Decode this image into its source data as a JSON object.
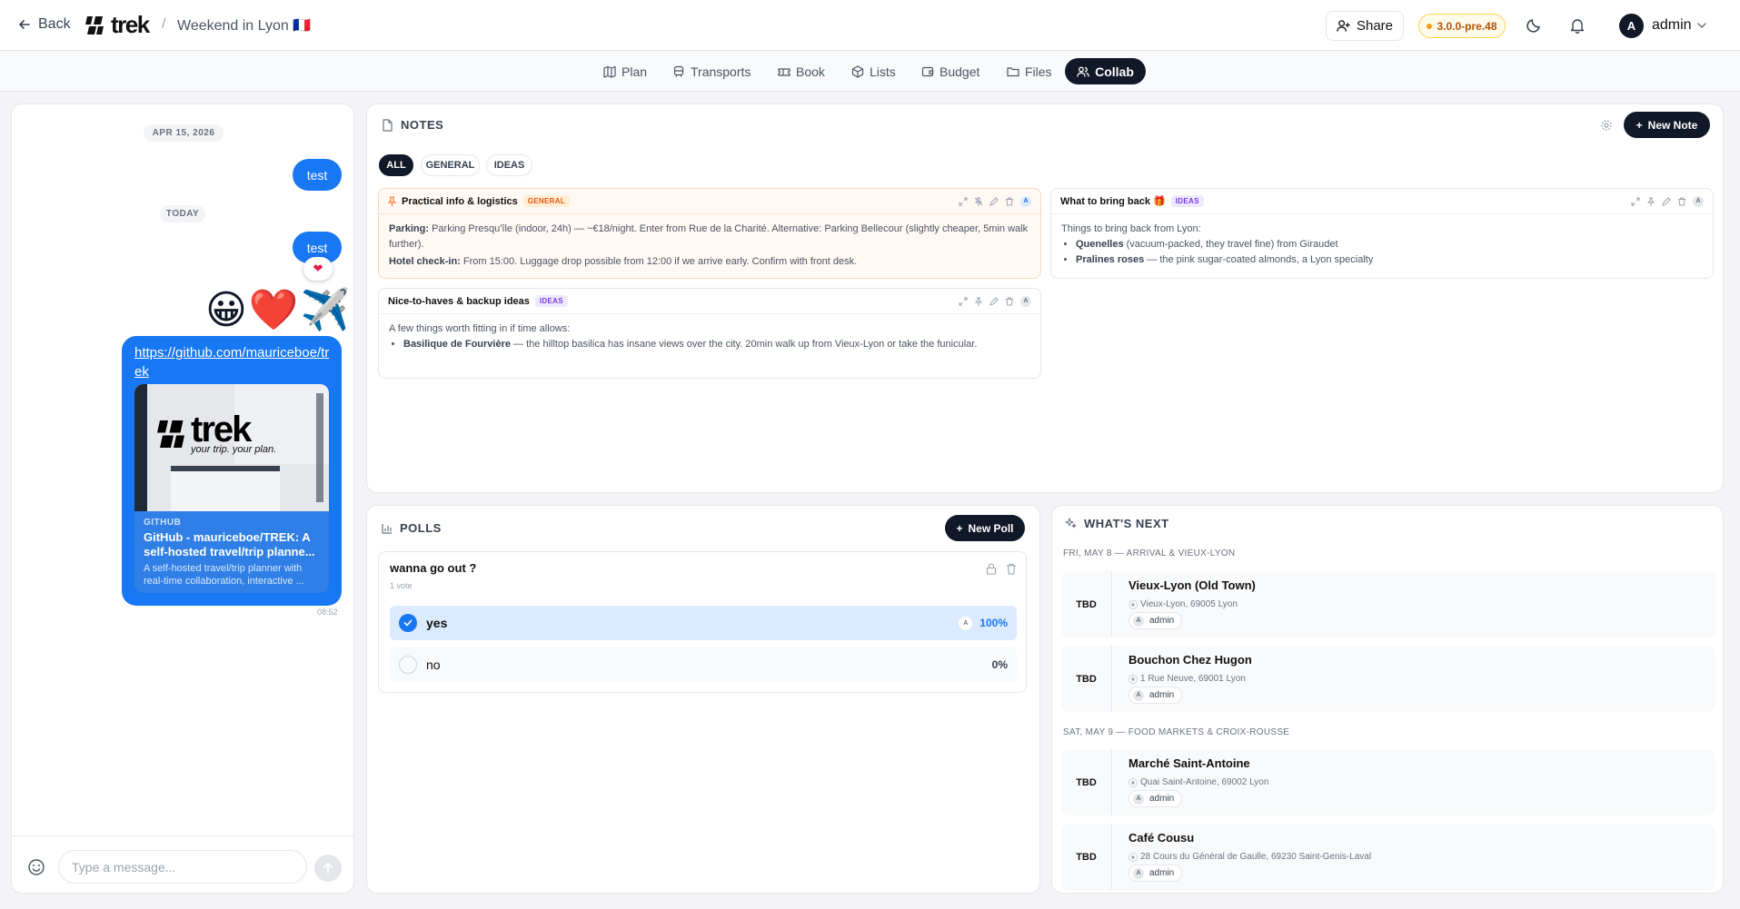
{
  "header": {
    "back_label": "Back",
    "logo_text": "trek",
    "separator": "/",
    "trip_title": "Weekend in Lyon 🇫🇷",
    "share_label": "Share",
    "version": "3.0.0-pre.48",
    "user_initial": "A",
    "user_name": "admin"
  },
  "tabs": [
    {
      "label": "Plan",
      "icon": "map-icon"
    },
    {
      "label": "Transports",
      "icon": "train-icon"
    },
    {
      "label": "Book",
      "icon": "ticket-icon"
    },
    {
      "label": "Lists",
      "icon": "package-icon"
    },
    {
      "label": "Budget",
      "icon": "wallet-icon"
    },
    {
      "label": "Files",
      "icon": "folder-icon"
    },
    {
      "label": "Collab",
      "icon": "users-icon",
      "active": true
    }
  ],
  "chat": {
    "date_old": "APR 15, 2026",
    "date_today": "TODAY",
    "msg1": "test",
    "msg2": "test",
    "reaction": "❤",
    "emoji_msg": "😀❤️✈️",
    "link_url": "https://github.com/mauriceboe/trek",
    "preview_logo": "trek",
    "preview_tagline": "your trip. your plan.",
    "preview_site": "GITHUB",
    "preview_title": "GitHub - mauriceboe/TREK: A self-hosted travel/trip planne...",
    "preview_desc": "A self-hosted travel/trip planner with real-time collaboration, interactive ...",
    "time": "08:52",
    "input_placeholder": "Type a message..."
  },
  "notes": {
    "title": "NOTES",
    "new_label": "New Note",
    "filters": [
      "ALL",
      "GENERAL",
      "IDEAS"
    ],
    "note1": {
      "title": "Practical info & logistics",
      "badge": "GENERAL",
      "line1_label": "Parking:",
      "line1_text": "Parking Presqu'île (indoor, 24h) — ~€18/night. Enter from Rue de la Charité. Alternative: Parking Bellecour (slightly cheaper, 5min walk further).",
      "line2_label": "Hotel check-in:",
      "line2_text": "From 15:00. Luggage drop possible from 12:00 if we arrive early. Confirm with front desk."
    },
    "note2": {
      "title": "What to bring back 🎁",
      "badge": "IDEAS",
      "intro": "Things to bring back from Lyon:",
      "item1_label": "Quenelles",
      "item1_text": "(vacuum-packed, they travel fine) from Giraudet",
      "item2_label": "Pralines roses",
      "item2_text": "— the pink sugar-coated almonds, a Lyon specialty"
    },
    "note3": {
      "title": "Nice-to-haves & backup ideas",
      "badge": "IDEAS",
      "intro": "A few things worth fitting in if time allows:",
      "item1_label": "Basilique de Fourvière",
      "item1_text": "— the hilltop basilica has insane views over the city. 20min walk up from Vieux-Lyon or take the funicular."
    },
    "author_initial": "A"
  },
  "polls": {
    "title": "POLLS",
    "new_label": "New Poll",
    "question": "wanna go out ?",
    "votes": "1 vote",
    "options": [
      {
        "label": "yes",
        "percent": "100%",
        "voter": "A",
        "selected": true
      },
      {
        "label": "no",
        "percent": "0%",
        "selected": false
      }
    ]
  },
  "whats_next": {
    "title": "WHAT'S NEXT",
    "days": [
      {
        "header": "FRI, MAY 8 — ARRIVAL & VIEUX-LYON",
        "items": [
          {
            "time": "TBD",
            "name": "Vieux-Lyon (Old Town)",
            "address": "Vieux-Lyon, 69005 Lyon",
            "user": "admin",
            "initial": "A"
          },
          {
            "time": "TBD",
            "name": "Bouchon Chez Hugon",
            "address": "1 Rue Neuve, 69001 Lyon",
            "user": "admin",
            "initial": "A"
          }
        ]
      },
      {
        "header": "SAT, MAY 9 — FOOD MARKETS & CROIX-ROUSSE",
        "items": [
          {
            "time": "TBD",
            "name": "Marché Saint-Antoine",
            "address": "Quai Saint-Antoine, 69002 Lyon",
            "user": "admin",
            "initial": "A"
          },
          {
            "time": "TBD",
            "name": "Café Cousu",
            "address": "28 Cours du Général de Gaulle, 69230 Saint-Genis-Laval",
            "user": "admin",
            "initial": "A"
          }
        ]
      }
    ]
  },
  "colors": {
    "accent": "#1877f2",
    "dark": "#111827",
    "version_bg": "#fffbeb",
    "general_badge": "#ea580c",
    "ideas_badge": "#7c3aed"
  }
}
